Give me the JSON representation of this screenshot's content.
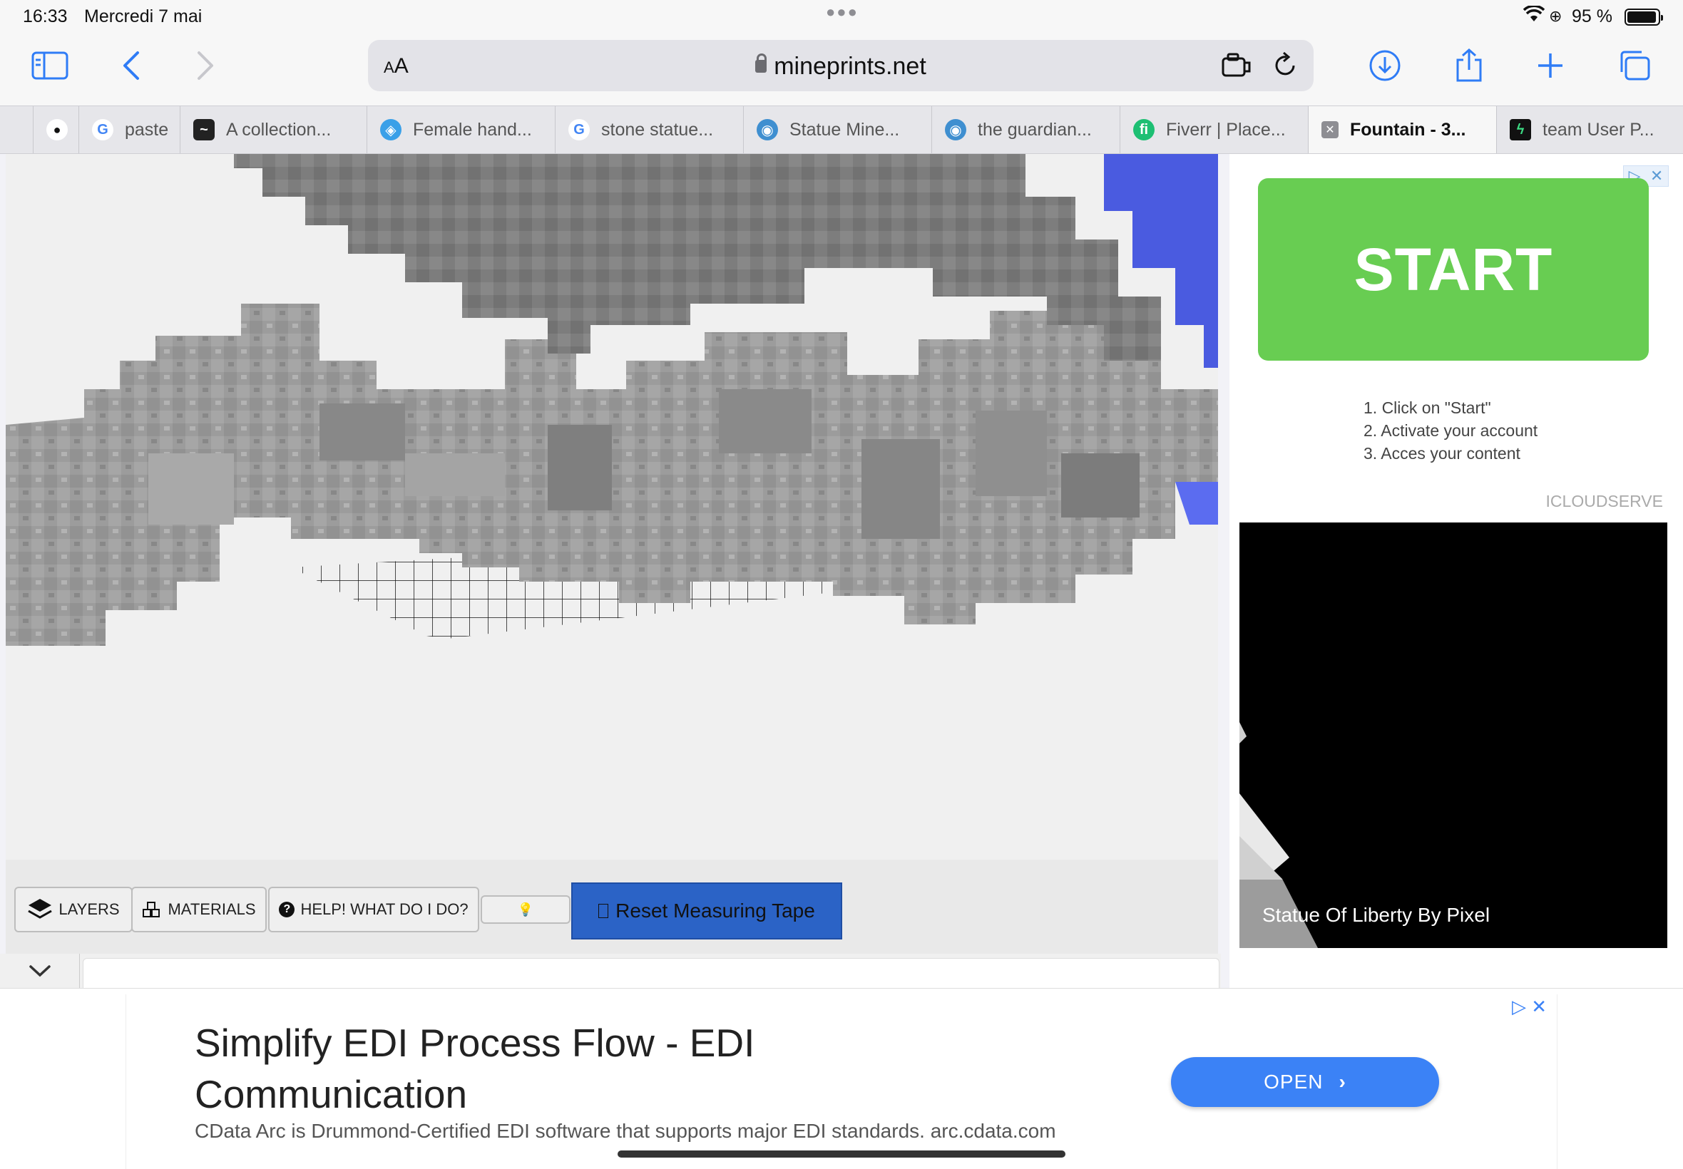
{
  "status_bar": {
    "time": "16:33",
    "date": "Mercredi 7 mai",
    "battery_percent": "95 %",
    "battery_level": 0.95
  },
  "toolbar": {
    "text_size_label": "AA",
    "url": "mineprints.net"
  },
  "tabs": [
    {
      "label": ""
    },
    {
      "label": "paste"
    },
    {
      "label": "A collection..."
    },
    {
      "label": "Female hand..."
    },
    {
      "label": "stone statue..."
    },
    {
      "label": "Statue Mine..."
    },
    {
      "label": "the guardian..."
    },
    {
      "label": "Fiverr | Place..."
    },
    {
      "label": "Fountain - 3...",
      "active": true
    },
    {
      "label": "team User P..."
    }
  ],
  "tools": {
    "layers": "LAYERS",
    "materials": "MATERIALS",
    "help": "HELP! WHAT DO I DO?",
    "reset": "Reset Measuring Tape"
  },
  "side_ad": {
    "start": "START",
    "steps": [
      "1. Click on \"Start\"",
      "2. Activate your account",
      "3. Acces your content"
    ],
    "brand": "ICLOUDSERVE",
    "video_caption": "Statue Of Liberty By Pixel"
  },
  "bottom_ad": {
    "headline": "Simplify EDI Process Flow - EDI Communication",
    "description": "CData Arc is Drummond-Certified EDI software that supports major EDI standards. arc.cdata.com",
    "cta": "OPEN"
  },
  "colors": {
    "accent": "#2b63c6",
    "start_green": "#68cd52",
    "open_blue": "#3b82f6",
    "stone": "#9a9a9a"
  }
}
